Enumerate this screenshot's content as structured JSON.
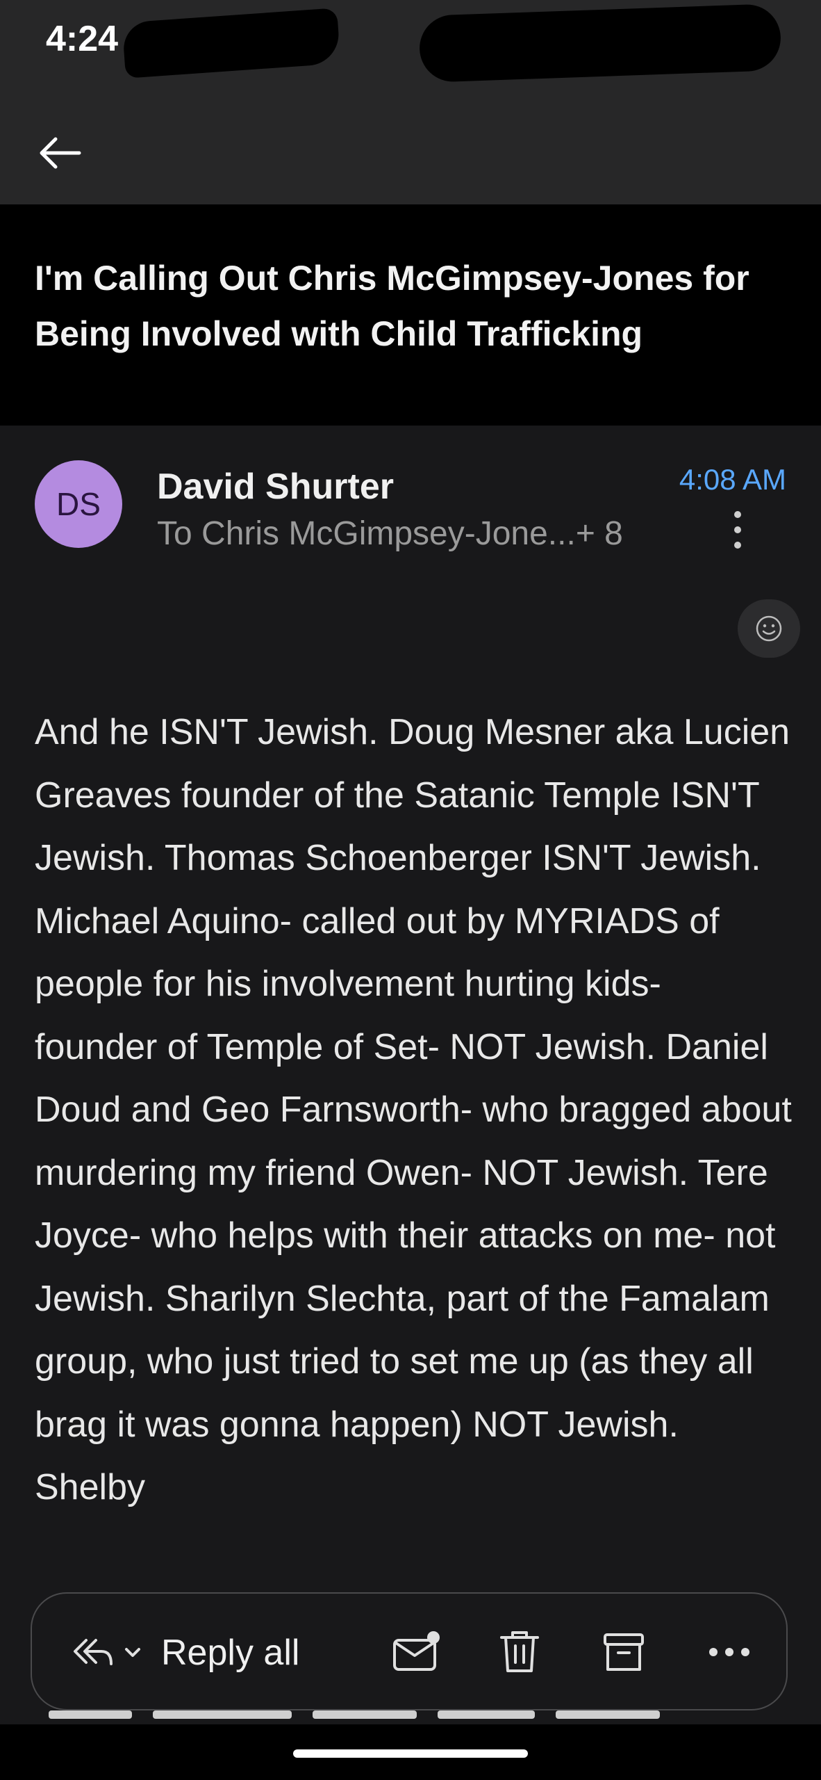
{
  "status_bar": {
    "time": "4:24"
  },
  "topbar": {
    "back_icon": "arrow-left-icon"
  },
  "email": {
    "subject": "I'm Calling Out Chris McGimpsey-Jones for Being Involved with Child Trafficking",
    "sender": {
      "initials": "DS",
      "name": "David Shurter",
      "avatar_color": "#b48be0"
    },
    "recipients": "To Chris McGimpsey-Jone...+ 8",
    "time": "4:08 AM",
    "time_color": "#5aa8ff",
    "body": "And he ISN'T Jewish. Doug Mesner aka Lucien Greaves founder of the Satanic Temple ISN'T Jewish. Thomas Schoenberger ISN'T Jewish. Michael Aquino- called out by MYRIADS of people for his involvement hurting kids- founder of Temple of Set- NOT Jewish. Daniel Doud and Geo Farnsworth- who bragged about murdering my friend Owen- NOT Jewish. Tere Joyce- who helps with their attacks on me- not Jewish.  Sharilyn Slechta, part of the Famalam group, who just tried to set me up (as they all brag it was gonna happen) NOT Jewish. Shelby"
  },
  "action_bar": {
    "reply_all_label": "Reply all",
    "icons": [
      "reply-all-icon",
      "chevron-down-icon",
      "mark-unread-icon",
      "trash-icon",
      "archive-icon",
      "more-horizontal-icon"
    ]
  }
}
